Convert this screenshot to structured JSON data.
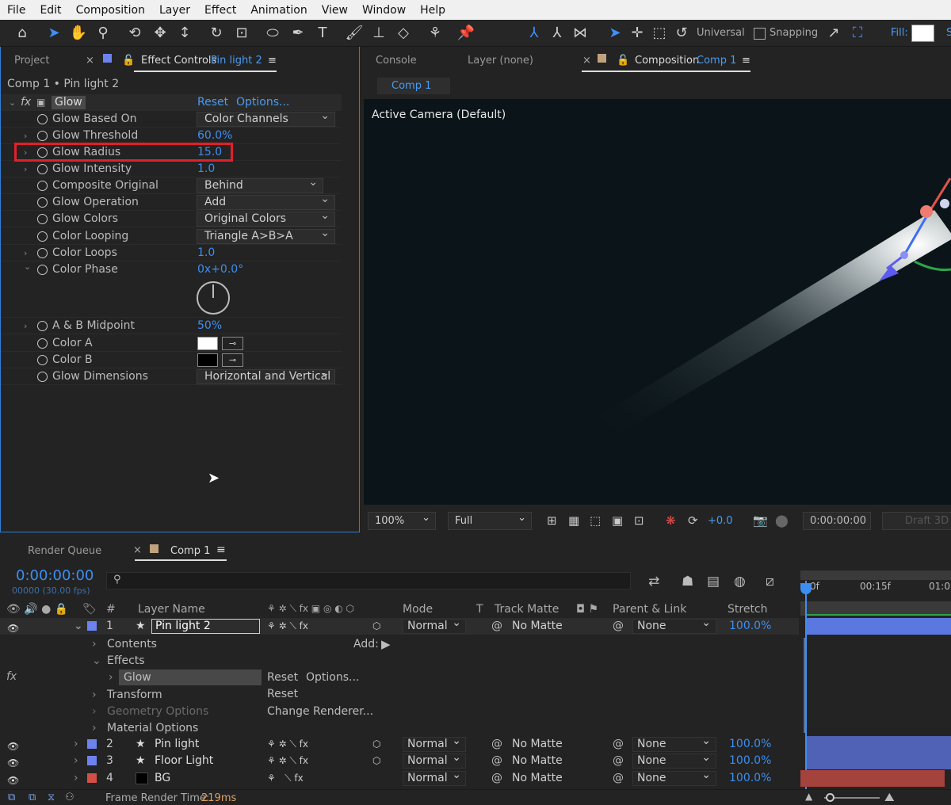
{
  "menu": [
    "File",
    "Edit",
    "Composition",
    "Layer",
    "Effect",
    "Animation",
    "View",
    "Window",
    "Help"
  ],
  "toolbar": {
    "universal": "Universal",
    "snapping": "Snapping",
    "fill": "Fill:",
    "stroke": "S"
  },
  "left_panel": {
    "tab_project": "Project",
    "tab_effect_controls": "Effect Controls",
    "tab_effect_layer": "Pin light 2",
    "breadcrumb": "Comp 1 • Pin light 2",
    "effect_name": "Glow",
    "reset": "Reset",
    "options": "Options...",
    "props": [
      {
        "name": "Glow Based On",
        "dropdown": "Color Channels"
      },
      {
        "name": "Glow Threshold",
        "value": "60.0%"
      },
      {
        "name": "Glow Radius",
        "value": "15.0"
      },
      {
        "name": "Glow Intensity",
        "value": "1.0"
      },
      {
        "name": "Composite Original",
        "dropdown": "Behind"
      },
      {
        "name": "Glow Operation",
        "dropdown": "Add"
      },
      {
        "name": "Glow Colors",
        "dropdown": "Original Colors"
      },
      {
        "name": "Color Looping",
        "dropdown": "Triangle A>B>A"
      },
      {
        "name": "Color Loops",
        "value": "1.0"
      },
      {
        "name": "Color Phase",
        "value": "0x+0.0°"
      },
      {
        "name": "A & B Midpoint",
        "value": "50%"
      },
      {
        "name": "Color A"
      },
      {
        "name": "Color B"
      },
      {
        "name": "Glow Dimensions",
        "dropdown": "Horizontal and Vertical"
      }
    ],
    "color_a": "#ffffff",
    "color_b": "#000000"
  },
  "right_panel": {
    "tab_console": "Console",
    "tab_layer": "Layer (none)",
    "tab_composition": "Composition",
    "tab_comp_name": "Comp 1",
    "subtab": "Comp 1",
    "camera_label": "Active Camera (Default)",
    "zoom": "100%",
    "resolution": "Full",
    "exposure": "+0.0",
    "timecode": "0:00:00:00",
    "draft": "Draft 3D"
  },
  "timeline": {
    "tab_render_queue": "Render Queue",
    "tab_comp": "Comp 1",
    "timecode": "0:00:00:00",
    "frames": "00000 (30.00 fps)",
    "search_placeholder": "",
    "hdr_layer_name": "Layer Name",
    "hdr_mode": "Mode",
    "hdr_t": "T",
    "hdr_track_matte": "Track Matte",
    "hdr_parent": "Parent & Link",
    "hdr_stretch": "Stretch",
    "hdr_hash": "#",
    "ruler": [
      "0f",
      "00:15f",
      "01:0"
    ],
    "layers": [
      {
        "num": "1",
        "name": "Pin light 2",
        "mode": "Normal",
        "matte": "No Matte",
        "parent": "None",
        "stretch": "100.0%",
        "color": "#6c83ef"
      },
      {
        "num": "2",
        "name": "Pin light",
        "mode": "Normal",
        "matte": "No Matte",
        "parent": "None",
        "stretch": "100.0%",
        "color": "#6c83ef"
      },
      {
        "num": "3",
        "name": "Floor Light",
        "mode": "Normal",
        "matte": "No Matte",
        "parent": "None",
        "stretch": "100.0%",
        "color": "#6c83ef"
      },
      {
        "num": "4",
        "name": "BG",
        "mode": "Normal",
        "matte": "No Matte",
        "parent": "None",
        "stretch": "100.0%",
        "color": "#d45046"
      }
    ],
    "contents": "Contents",
    "add": "Add:",
    "effects": "Effects",
    "glow": "Glow",
    "reset": "Reset",
    "options": "Options...",
    "transform": "Transform",
    "transform_reset": "Reset",
    "geometry": "Geometry Options",
    "change_renderer": "Change Renderer...",
    "material": "Material Options",
    "frame_render_label": "Frame Render Time:",
    "frame_render_value": "219ms"
  },
  "accent_color": "#3d8ef0",
  "highlight_color": "#e0202a"
}
